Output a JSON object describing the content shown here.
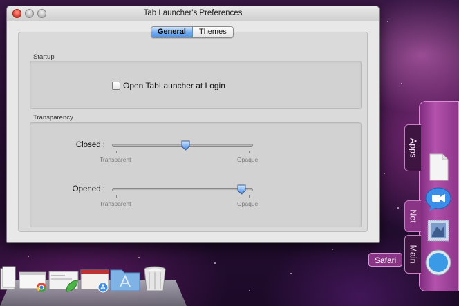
{
  "window": {
    "title": "Tab Launcher's Preferences"
  },
  "tabs": [
    {
      "label": "General",
      "active": true
    },
    {
      "label": "Themes",
      "active": false
    }
  ],
  "startup": {
    "group_label": "Startup",
    "checkbox_label": "Open TabLauncher at Login",
    "checked": false
  },
  "transparency": {
    "group_label": "Transparency",
    "sliders": [
      {
        "label": "Closed :",
        "min_label": "Transparent",
        "max_label": "Opaque",
        "value": 0.5
      },
      {
        "label": "Opened :",
        "min_label": "Transparent",
        "max_label": "Opaque",
        "value": 0.9
      }
    ]
  },
  "launcher": {
    "tabs": [
      "Apps",
      "Net",
      "Main"
    ],
    "active_tab": "Net",
    "tooltip": "Safari",
    "icons": [
      "document-icon",
      "ichat-icon",
      "mail-stamp-icon",
      "safari-icon"
    ]
  },
  "dock": {
    "icons": [
      "document-stack-icon",
      "window-preview-icon",
      "chrome-icon",
      "window-preview-icon",
      "leaf-icon",
      "window-preview-icon",
      "app-store-icon",
      "applications-folder-icon",
      "trash-icon"
    ]
  },
  "colors": {
    "accent_blue": "#4f93ea",
    "launcher_purple": "#8a3485"
  }
}
